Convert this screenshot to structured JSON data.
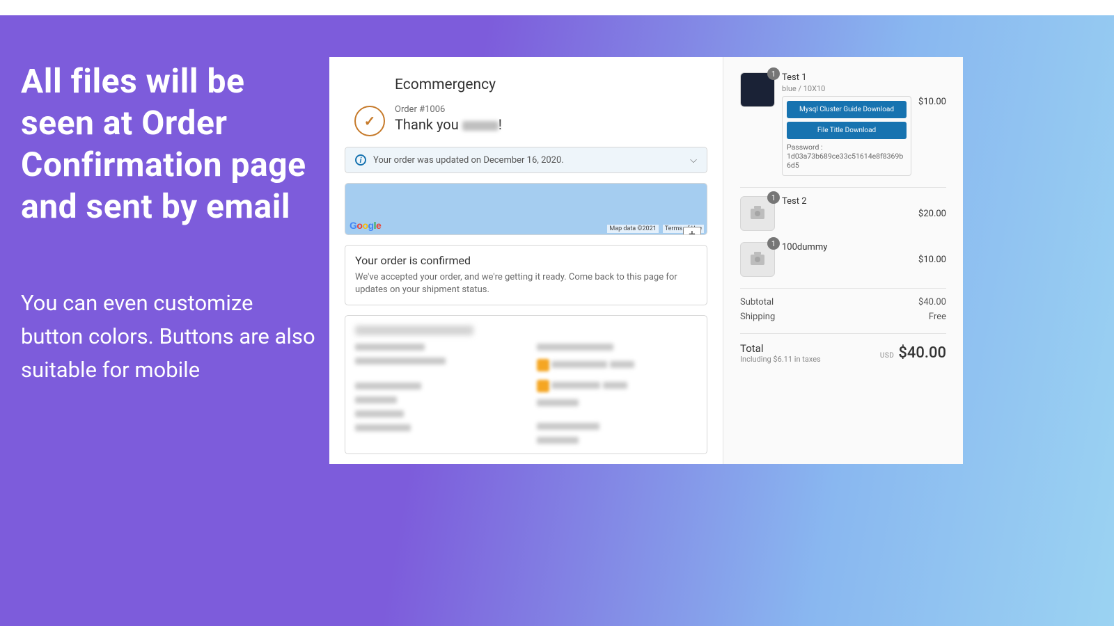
{
  "promo": {
    "headline": "All files will be seen at Order Confirmation page and sent by email",
    "subline": "You can even customize button colors. Buttons are also suitable for mobile"
  },
  "store": {
    "name": "Ecommergency"
  },
  "order": {
    "number": "Order #1006",
    "thank_prefix": "Thank you ",
    "thank_suffix": "!",
    "updated_text": "Your order was updated on December 16, 2020."
  },
  "map": {
    "logo_chars": [
      "G",
      "o",
      "o",
      "g",
      "l",
      "e"
    ],
    "logo_colors": [
      "#4285F4",
      "#EA4335",
      "#FBBC05",
      "#4285F4",
      "#34A853",
      "#EA4335"
    ],
    "attr1": "Map data ©2021",
    "attr2": "Terms of Use"
  },
  "confirm": {
    "title": "Your order is confirmed",
    "text": "We've accepted your order, and we're getting it ready. Come back to this page for updates on your shipment status."
  },
  "items": [
    {
      "name": "Test 1",
      "variant": "blue / 10X10",
      "qty": "1",
      "price": "$10.00",
      "downloads": [
        "Mysql Cluster Guide Download",
        "File Title Download"
      ],
      "password_label": "Password :",
      "password_value": "1d03a73b689ce33c51614e8f8369b6d5"
    },
    {
      "name": "Test 2",
      "variant": "",
      "qty": "1",
      "price": "$20.00"
    },
    {
      "name": "100dummy",
      "variant": "",
      "qty": "1",
      "price": "$10.00"
    }
  ],
  "summary": {
    "subtotal_label": "Subtotal",
    "subtotal": "$40.00",
    "shipping_label": "Shipping",
    "shipping": "Free",
    "total_label": "Total",
    "tax_note": "Including $6.11 in taxes",
    "currency": "USD",
    "total": "$40.00"
  }
}
